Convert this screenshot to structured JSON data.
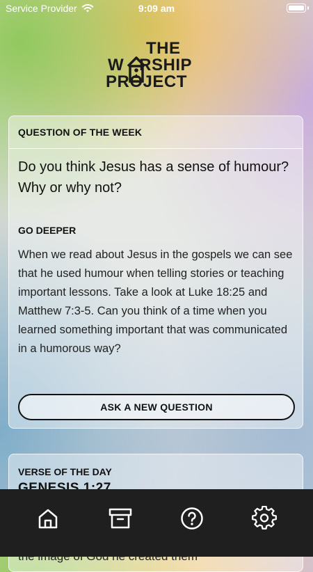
{
  "status_bar": {
    "carrier": "Service Provider",
    "time": "9:09 am"
  },
  "logo": {
    "line1": "THE",
    "line2": "W",
    "line2_rest": "RSHIP",
    "line3": "PROJECT"
  },
  "question_card": {
    "header": "QUESTION OF THE WEEK",
    "question": "Do you think Jesus has a sense of humour? Why or why not?",
    "go_deeper_label": "GO DEEPER",
    "go_deeper_text": "When we read about Jesus in the gospels we can see that he used humour when telling stories or teaching important lessons. Take a look at Luke 18:25 and Matthew 7:3-5. Can you think of a time when you learned something important that was communicated in a humorous way?",
    "button_label": "ASK A NEW QUESTION"
  },
  "verse_card": {
    "label": "VERSE OF THE DAY",
    "reference": "GENESIS 1:27",
    "text": "So God created human beings in his own image, to the image of God he created them"
  },
  "tab_bar": {
    "items": [
      {
        "icon": "home-icon"
      },
      {
        "icon": "archive-icon"
      },
      {
        "icon": "help-icon"
      },
      {
        "icon": "settings-icon"
      }
    ]
  }
}
